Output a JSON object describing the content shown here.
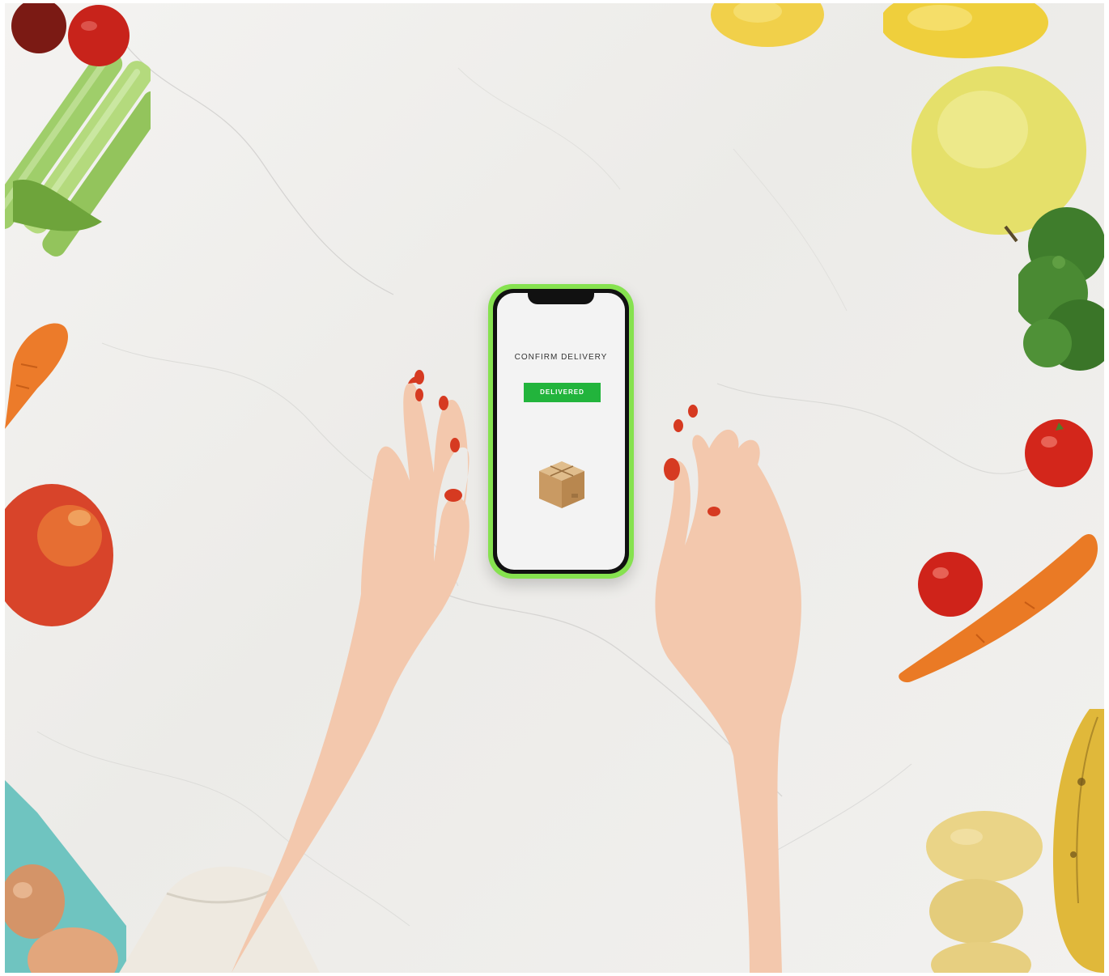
{
  "photo": {
    "phone_app": {
      "title": "CONFIRM DELIVERY",
      "button_label": "DELIVERED",
      "icon": "package-icon",
      "colors": {
        "phone_case": "#86e24f",
        "button": "#22b43c"
      }
    },
    "items": [
      "celery",
      "tomato",
      "carrot",
      "apple",
      "lemon",
      "broccoli",
      "eggs",
      "potato",
      "banana"
    ]
  }
}
